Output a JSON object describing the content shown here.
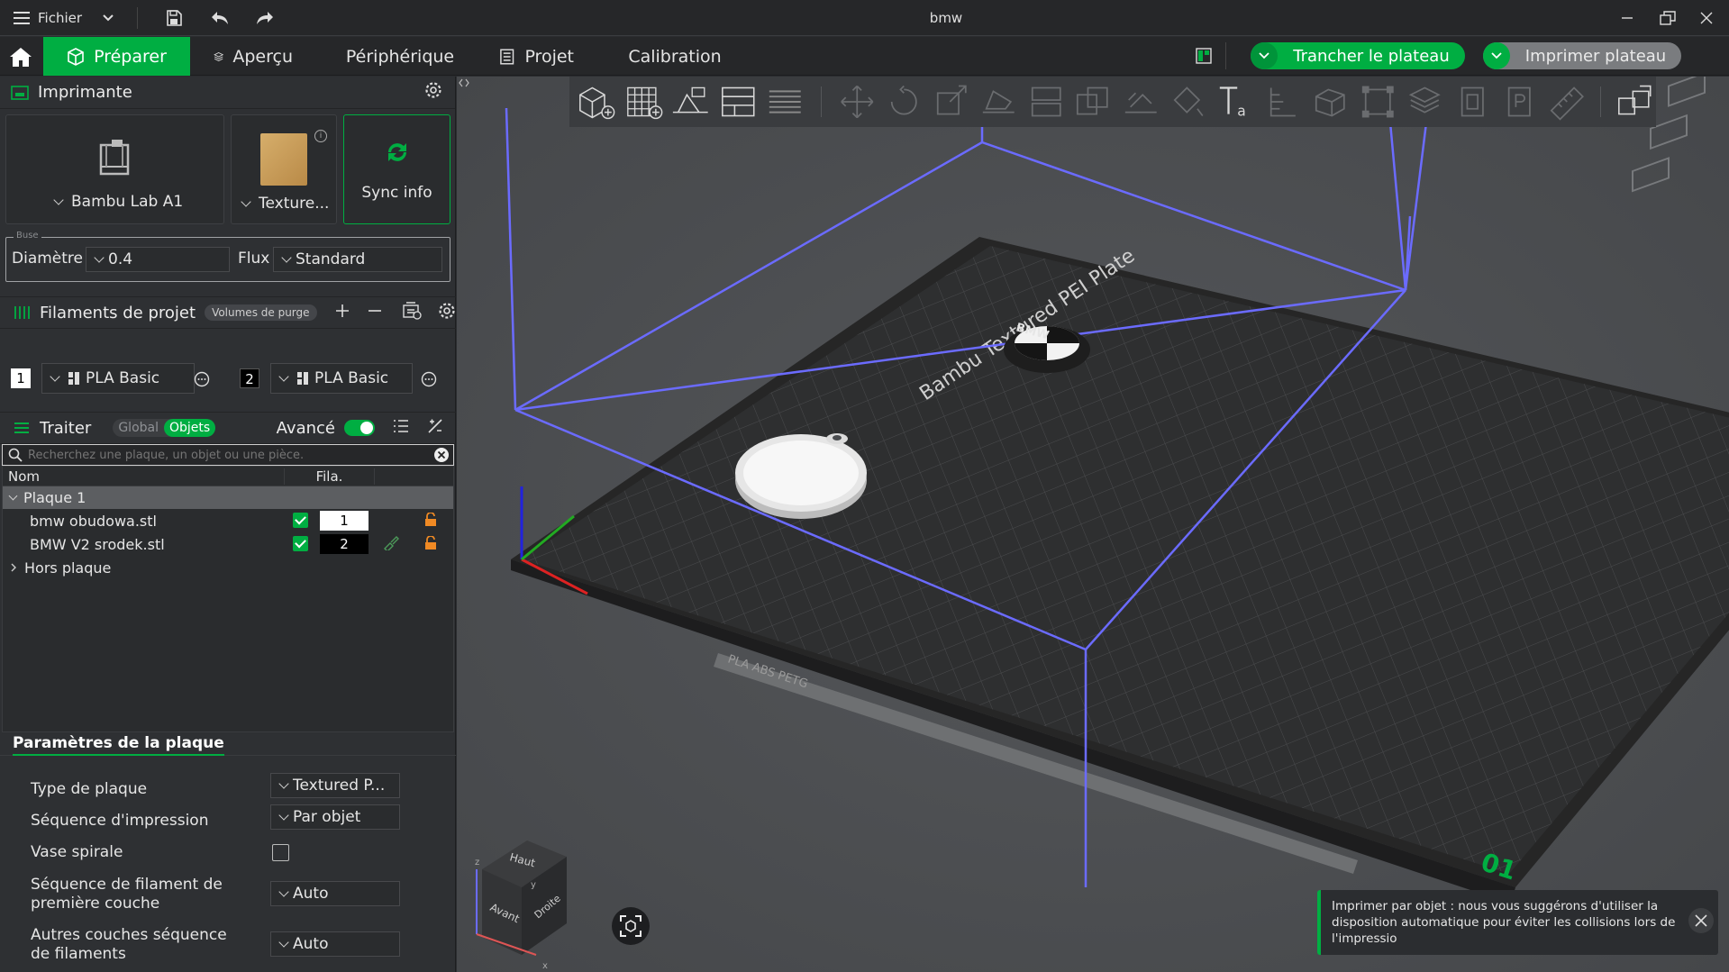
{
  "titlebar": {
    "menu_label": "Fichier",
    "title": "bmw"
  },
  "tabs": [
    {
      "label": "Préparer"
    },
    {
      "label": "Aperçu"
    },
    {
      "label": "Périphérique"
    },
    {
      "label": "Projet"
    },
    {
      "label": "Calibration"
    }
  ],
  "actions": {
    "slice_label": "Trancher le plateau",
    "print_label": "Imprimer plateau"
  },
  "printer": {
    "section_title": "Imprimante",
    "printer_name": "Bambu Lab A1",
    "plate_name": "Texture...",
    "sync_label": "Sync info",
    "nozzle_group": "Buse",
    "diameter_label": "Diamètre",
    "diameter_value": "0.4",
    "flux_label": "Flux",
    "flux_value": "Standard"
  },
  "filaments": {
    "section_title": "Filaments de projet",
    "purge_label": "Volumes de purge",
    "items": [
      {
        "index": "1",
        "name": "PLA Basic",
        "color": "#ffffff"
      },
      {
        "index": "2",
        "name": "PLA Basic",
        "color": "#000000"
      }
    ]
  },
  "process": {
    "section_title": "Traiter",
    "global_label": "Global",
    "objects_label": "Objets",
    "advanced_label": "Avancé",
    "search_placeholder": "Recherchez une plaque, un objet ou une pièce."
  },
  "object_list": {
    "col_name": "Nom",
    "col_fila": "Fila.",
    "plate": "Plaque 1",
    "objects": [
      {
        "name": "bmw obudowa.stl",
        "filament": "1"
      },
      {
        "name": "BMW V2 srodek.stl",
        "filament": "2"
      }
    ],
    "off_plate": "Hors plaque"
  },
  "plate_settings": {
    "tab_label": "Paramètres de la plaque",
    "rows": [
      {
        "label": "Type de plaque",
        "value": "Textured P..."
      },
      {
        "label": "Séquence d'impression",
        "value": "Par objet"
      },
      {
        "label": "Vase spirale",
        "value": ""
      },
      {
        "label": "Séquence de filament de première couche",
        "value": "Auto"
      },
      {
        "label": "Autres couches séquence de filaments",
        "value": "Auto"
      }
    ]
  },
  "scene": {
    "bed_label": "Bambu Textured PEI Plate",
    "plate_number": "01",
    "bed_strip": "PLA ABS PETG",
    "logo_text": "BMW",
    "cube_top": "Haut",
    "cube_front": "Avant",
    "cube_right": "Droite",
    "axis_x": "x",
    "axis_y": "y",
    "axis_z": "z"
  },
  "notification": {
    "text": "Imprimer par objet : nous vous suggérons d'utiliser la disposition automatique pour éviter les collisions lors de l'impressio"
  },
  "colors": {
    "accent": "#00ae42",
    "panel": "#2e3033",
    "viewport": "#4a4c4f"
  }
}
